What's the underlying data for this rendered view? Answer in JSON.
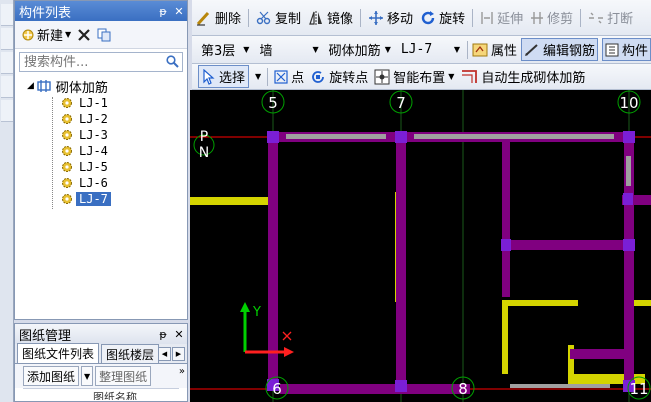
{
  "component_panel": {
    "title": "构件列表",
    "pin_glyph": "ᵽ",
    "close_glyph": "✕",
    "new_label": "新建",
    "search_placeholder": "搜索构件...",
    "tree": {
      "root_label": "砌体加筋",
      "items": [
        {
          "label": "LJ-1",
          "selected": false
        },
        {
          "label": "LJ-2",
          "selected": false
        },
        {
          "label": "LJ-3",
          "selected": false
        },
        {
          "label": "LJ-4",
          "selected": false
        },
        {
          "label": "LJ-5",
          "selected": false
        },
        {
          "label": "LJ-6",
          "selected": false
        },
        {
          "label": "LJ-7",
          "selected": true
        }
      ]
    }
  },
  "drawing_panel": {
    "title": "图纸管理",
    "pin_glyph": "ᵽ",
    "close_glyph": "✕",
    "tabs": [
      "图纸文件列表",
      "图纸楼层"
    ],
    "add_drawing_label": "添加图纸",
    "organize_label": "整理图纸",
    "more_glyph": "»",
    "column_header": "图纸名称"
  },
  "toolbar1": {
    "delete": "删除",
    "copy": "复制",
    "mirror": "镜像",
    "move": "移动",
    "rotate": "旋转",
    "extend": "延伸",
    "trim": "修剪",
    "break": "打断"
  },
  "toolbar2": {
    "floor": "第3层",
    "type": "墙",
    "subtype": "砌体加筋",
    "component": "LJ-7",
    "properties": "属性",
    "edit_rebar": "编辑钢筋",
    "component_list": "构件"
  },
  "toolbar3": {
    "select": "选择",
    "point": "点",
    "rotate_point": "旋转点",
    "smart_place": "智能布置",
    "auto_generate": "自动生成砌体加筋"
  },
  "canvas": {
    "axis_labels_top": [
      "5",
      "7",
      "10"
    ],
    "axis_labels_bottom": [
      "6",
      "8",
      "11"
    ],
    "compass": [
      "P",
      "N"
    ],
    "ucs_y": "Y",
    "colors": {
      "background": "#000000",
      "wall": "#d4d400",
      "beam": "#800080",
      "column": "#7a1fd6",
      "rebar": "#a0a0a0",
      "axis_circle": "#00a000",
      "red_line": "#ff0000"
    }
  }
}
